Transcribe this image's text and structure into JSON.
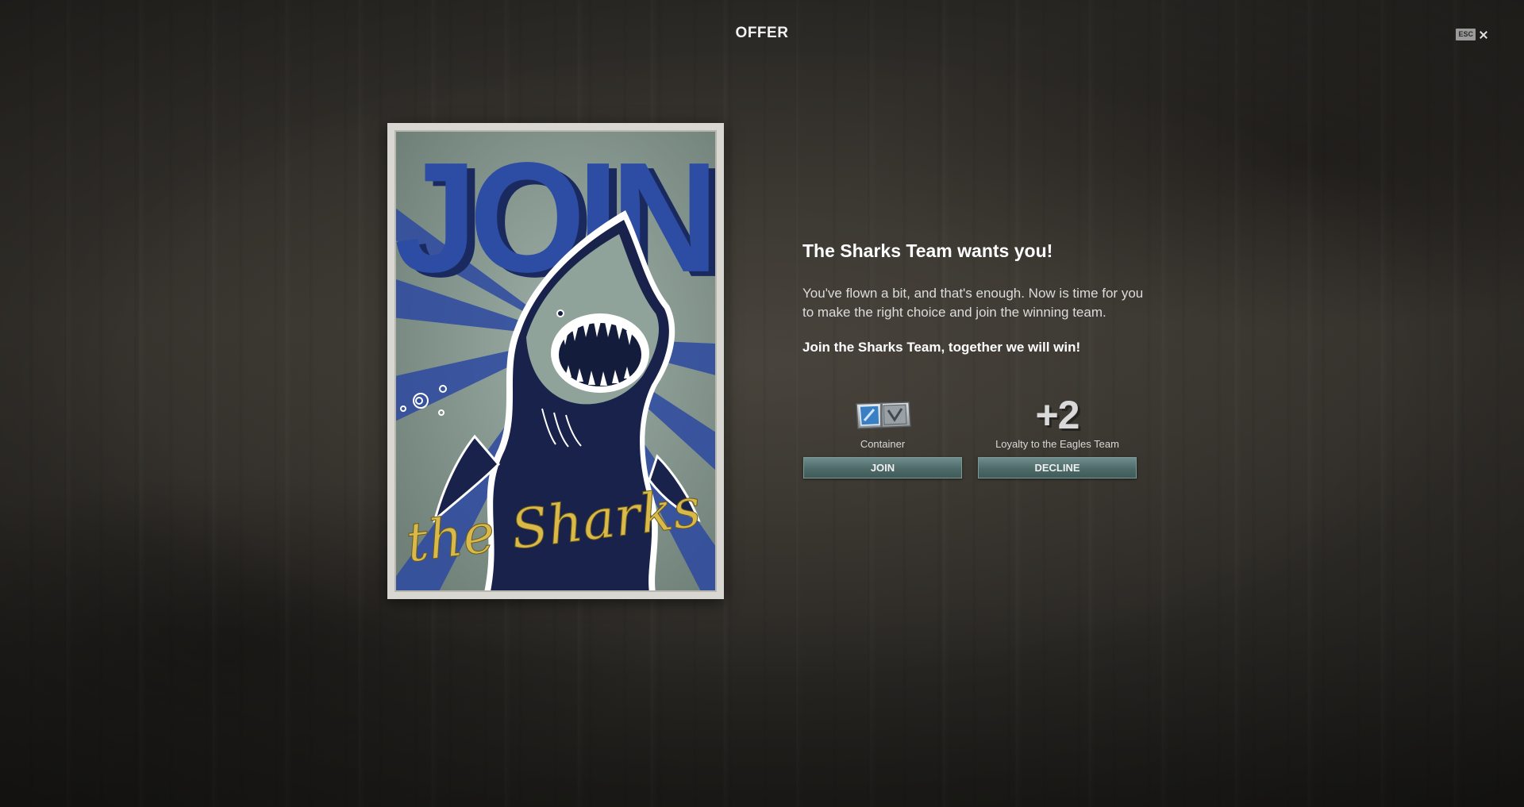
{
  "header": {
    "title": "OFFER",
    "esc_label": "ESC"
  },
  "poster": {
    "headline": "JOIN",
    "script": "the Sharks"
  },
  "offer": {
    "title": "The Sharks Team wants you!",
    "body": "You've flown a bit, and that's enough. Now is time for you to make the right choice and join the winning team.",
    "call_to_action": "Join the Sharks Team, together we will win!"
  },
  "choices": {
    "join": {
      "reward_label": "Container",
      "reward_icon": "container-icon",
      "button_label": "JOIN"
    },
    "decline": {
      "reward_value": "+2",
      "reward_label": "Loyalty to the Eagles Team",
      "button_label": "DECLINE"
    }
  },
  "colors": {
    "button_teal": "#4d6a69",
    "poster_blue": "#2b4a9e",
    "poster_gold": "#d8b94a",
    "poster_bg": "#8a9b94"
  }
}
